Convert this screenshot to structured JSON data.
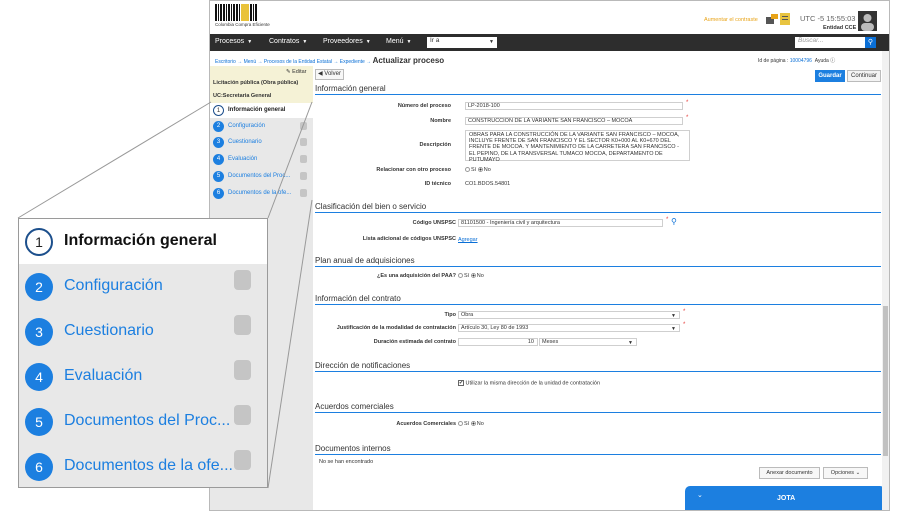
{
  "topbar": {
    "logo_text": "Colombia Compra Eficiente",
    "highlight_link": "Aumentar el contraste",
    "utc": "UTC -5 15:55:03",
    "entity": "Entidad CCE"
  },
  "nav": {
    "items": [
      "Procesos",
      "Contratos",
      "Proveedores",
      "Menú"
    ],
    "go_label": "Ir a",
    "search_placeholder": "Buscar..."
  },
  "breadcrumb": {
    "trail": "Escritorio → Menú → Procesos de la Entidad Estatal → Expediente → ",
    "current": "Actualizar proceso"
  },
  "page_id": {
    "label": "Id de página :",
    "value": "10004796",
    "help": "Ayuda ⓘ"
  },
  "sidebar": {
    "edit": "Editar",
    "process_type": "Licitación pública (Obra pública)",
    "unit": "UC:Secretaria General",
    "steps": [
      {
        "num": "1",
        "label": "Información general"
      },
      {
        "num": "2",
        "label": "Configuración"
      },
      {
        "num": "3",
        "label": "Cuestionario"
      },
      {
        "num": "4",
        "label": "Evaluación"
      },
      {
        "num": "5",
        "label": "Documentos del Proc..."
      },
      {
        "num": "6",
        "label": "Documentos de la ofe..."
      }
    ]
  },
  "toolbar": {
    "back": "Volver",
    "save": "Guardar",
    "continue": "Continuar"
  },
  "general": {
    "title": "Información general",
    "process_number_label": "Número del proceso",
    "process_number": "LP-2018-100",
    "name_label": "Nombre",
    "name": "CONSTRUCCIÓN DE LA VARIANTE SAN FRANCISCO – MOCOA",
    "description_label": "Descripción",
    "description": "OBRAS PARA LA CONSTRUCCIÓN DE LA VARIANTE SAN FRANCISCO – MOCOA, INCLUYE FRENTE DE SAN FRANCISCO Y EL SECTOR K0+000 AL K0+670 DEL FRENTE DE MOCOA. Y MANTENIMIENTO DE LA CARRETERA SAN FRANCISCO - EL PEPINO, DE LA TRANSVERSAL TUMACO MOCOA, DEPARTAMENTO DE PUTUMAYO",
    "relate_label": "Relacionar con otro proceso",
    "yes": "Sí",
    "no": "No",
    "tech_id_label": "ID técnico",
    "tech_id": "CO1.BDOS.54801"
  },
  "classification": {
    "title": "Clasificación del bien o servicio",
    "unspsc_label": "Código UNSPSC",
    "unspsc": "81101500 - Ingeniería civil y arquitectura",
    "additional_label": "Lista adicional de códigos UNSPSC",
    "add_link": "Agregar"
  },
  "paa": {
    "title": "Plan anual de adquisiciones",
    "question": "¿Es una adquisición del PAA?",
    "yes": "Sí",
    "no": "No"
  },
  "contract": {
    "title": "Información del contrato",
    "type_label": "Tipo",
    "type": "Obra",
    "justification_label": "Justificación de la modalidad de contratación",
    "justification": "Artículo 30, Ley 80 de 1993",
    "duration_label": "Duración estimada del contrato",
    "duration": "10",
    "duration_unit": "Meses"
  },
  "notifications": {
    "title": "Dirección de notificaciones",
    "checkbox": "Utilizar la misma dirección de la unidad de contratación"
  },
  "agreements": {
    "title": "Acuerdos comerciales",
    "label": "Acuerdos Comerciales",
    "yes": "Sí",
    "no": "No"
  },
  "internal_docs": {
    "title": "Documentos internos",
    "empty": "No se han encontrado",
    "attach": "Anexar documento",
    "options": "Opciones"
  },
  "chat": {
    "title": "JOTA"
  },
  "zoom": {
    "steps": [
      {
        "num": "1",
        "label": "Información general"
      },
      {
        "num": "2",
        "label": "Configuración"
      },
      {
        "num": "3",
        "label": "Cuestionario"
      },
      {
        "num": "4",
        "label": "Evaluación"
      },
      {
        "num": "5",
        "label": "Documentos del Proc..."
      },
      {
        "num": "6",
        "label": "Documentos de la ofe..."
      }
    ]
  },
  "colors": {
    "accent": "#1c7fe0",
    "navbar": "#2d2d2d",
    "sidebar_head": "#f5f2d6",
    "required": "#e53935"
  }
}
